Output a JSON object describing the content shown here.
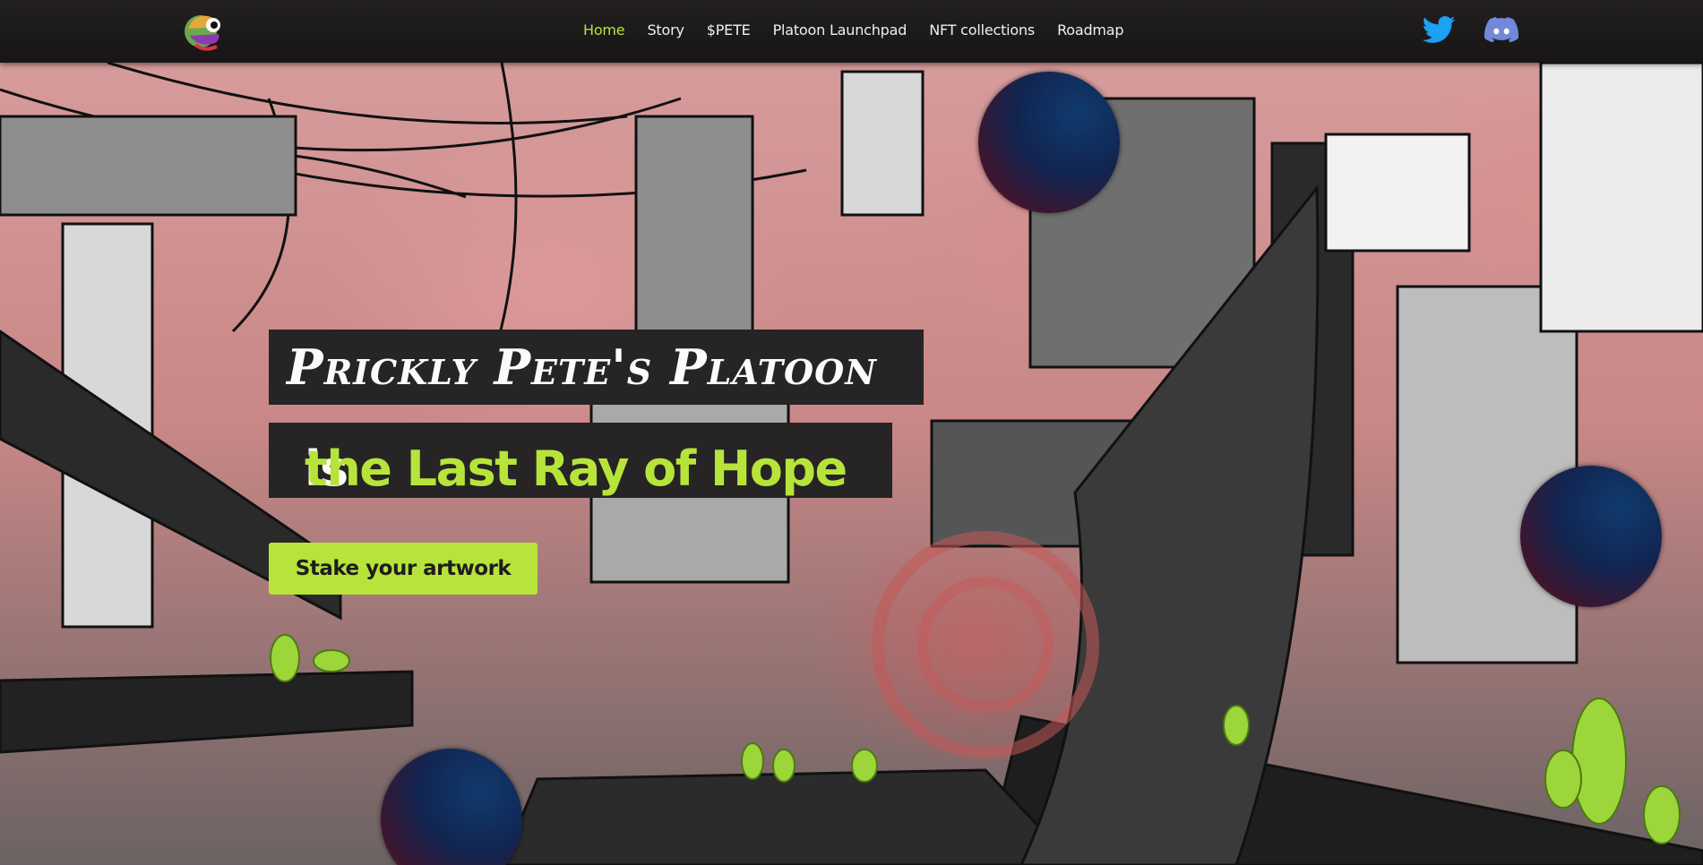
{
  "nav": {
    "logo_icon": "chameleon-logo-icon",
    "items": [
      {
        "label": "Home",
        "active": true
      },
      {
        "label": "Story"
      },
      {
        "label": "$PETE"
      },
      {
        "label": "Platoon Launchpad"
      },
      {
        "label": "NFT collections"
      },
      {
        "label": "Roadmap"
      }
    ],
    "social": {
      "twitter_icon": "twitter-icon",
      "discord_icon": "discord-icon"
    }
  },
  "hero": {
    "title_line1": "Prickly Pete's Platoon",
    "title_line2_prefix": "is ",
    "title_line2_highlight": "the Last Ray of Hope",
    "cta_label": "Stake your artwork"
  },
  "colors": {
    "accent": "#b7e43a",
    "nav_bg": "#1c1a1a",
    "title_bg": "#262424",
    "twitter": "#1da1f2",
    "discord": "#7289da"
  }
}
